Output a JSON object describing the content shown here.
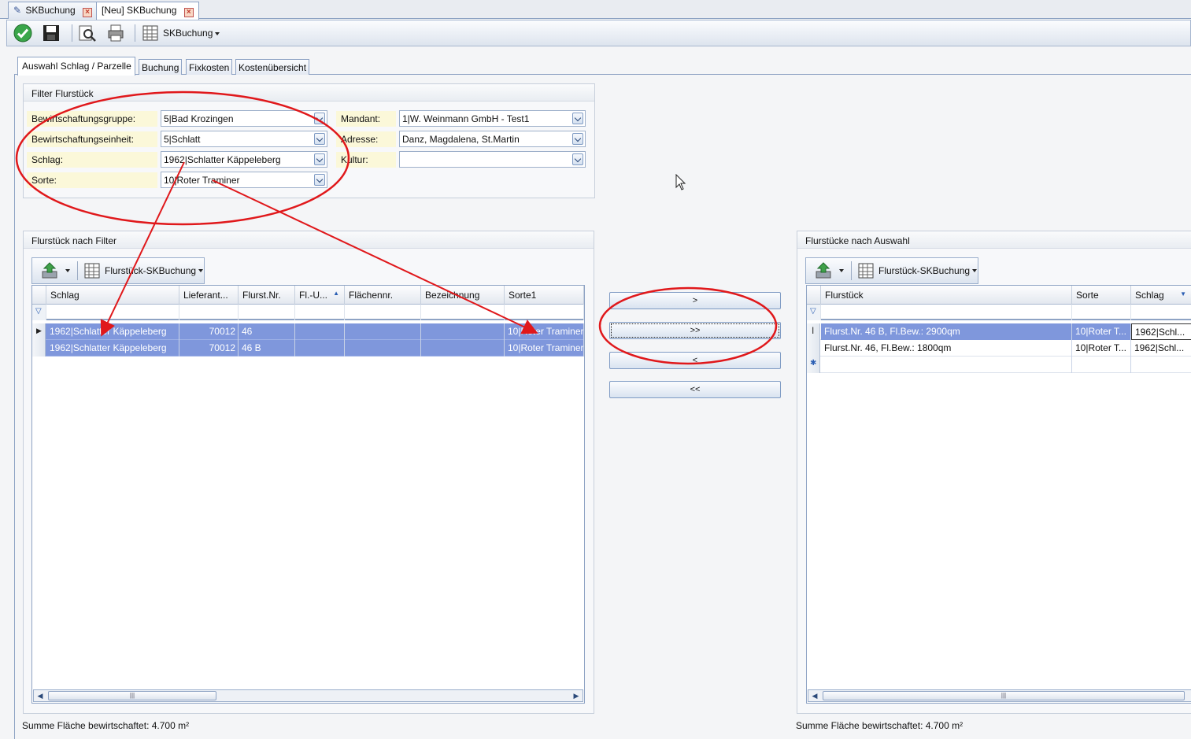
{
  "doc_tabs": [
    {
      "label": "SKBuchung"
    },
    {
      "label": "[Neu] SKBuchung"
    }
  ],
  "toolbar": {
    "layout_label": "SKBuchung",
    "icons": [
      "check-icon",
      "save-icon",
      "preview-icon",
      "print-icon",
      "grid-layout-icon"
    ]
  },
  "main_tabs": [
    {
      "label": "Auswahl Schlag / Parzelle"
    },
    {
      "label": "Buchung"
    },
    {
      "label": "Fixkosten"
    },
    {
      "label": "Kostenübersicht"
    }
  ],
  "filter": {
    "title": "Filter Flurstück",
    "bewirtschaftungsgruppe": {
      "label": "Bewirtschaftungsgruppe:",
      "value": "5|Bad Krozingen"
    },
    "bewirtschaftungseinheit": {
      "label": "Bewirtschaftungseinheit:",
      "value": "5|Schlatt"
    },
    "schlag": {
      "label": "Schlag:",
      "value": "1962|Schlatter Käppeleberg"
    },
    "sorte": {
      "label": "Sorte:",
      "value": "10|Roter Traminer"
    },
    "mandant": {
      "label": "Mandant:",
      "value": "1|W. Weinmann GmbH - Test1"
    },
    "adresse": {
      "label": "Adresse:",
      "value": "Danz, Magdalena, St.Martin"
    },
    "kultur": {
      "label": "Kultur:",
      "value": ""
    }
  },
  "left_panel": {
    "title": "Flurstück nach Filter",
    "grid_layout_label": "Flurstück-SKBuchung",
    "columns": [
      "Schlag",
      "Lieferant...",
      "Flurst.Nr.",
      "Fl.-U...",
      "Flächennr.",
      "Bezeichnung",
      "Sorte1"
    ],
    "rows": [
      [
        "1962|Schlatter Käppeleberg",
        "70012",
        "46",
        "",
        "",
        "",
        "10|Roter Traminer"
      ],
      [
        "1962|Schlatter Käppeleberg",
        "70012",
        "46 B",
        "",
        "",
        "",
        "10|Roter Traminer"
      ]
    ],
    "summary": "Summe Fläche bewirtschaftet: 4.700 m²"
  },
  "transfer_buttons": {
    "add_one": ">",
    "add_all": ">>",
    "remove_one": "<",
    "remove_all": "<<"
  },
  "right_panel": {
    "title": "Flurstücke nach Auswahl",
    "grid_layout_label": "Flurstück-SKBuchung",
    "columns": [
      "Flurstück",
      "Sorte",
      "Schlag"
    ],
    "rows": [
      [
        "Flurst.Nr. 46 B, Fl.Bew.: 2900qm",
        "10|Roter T...",
        "1962|Schl..."
      ],
      [
        "Flurst.Nr. 46, Fl.Bew.: 1800qm",
        "10|Roter T...",
        "1962|Schl..."
      ]
    ],
    "summary": "Summe Fläche bewirtschaftet: 4.700 m²"
  },
  "colors": {
    "selection": "#7f97dc",
    "annotation": "#e0181b",
    "label_bg": "#fbf8d9"
  }
}
